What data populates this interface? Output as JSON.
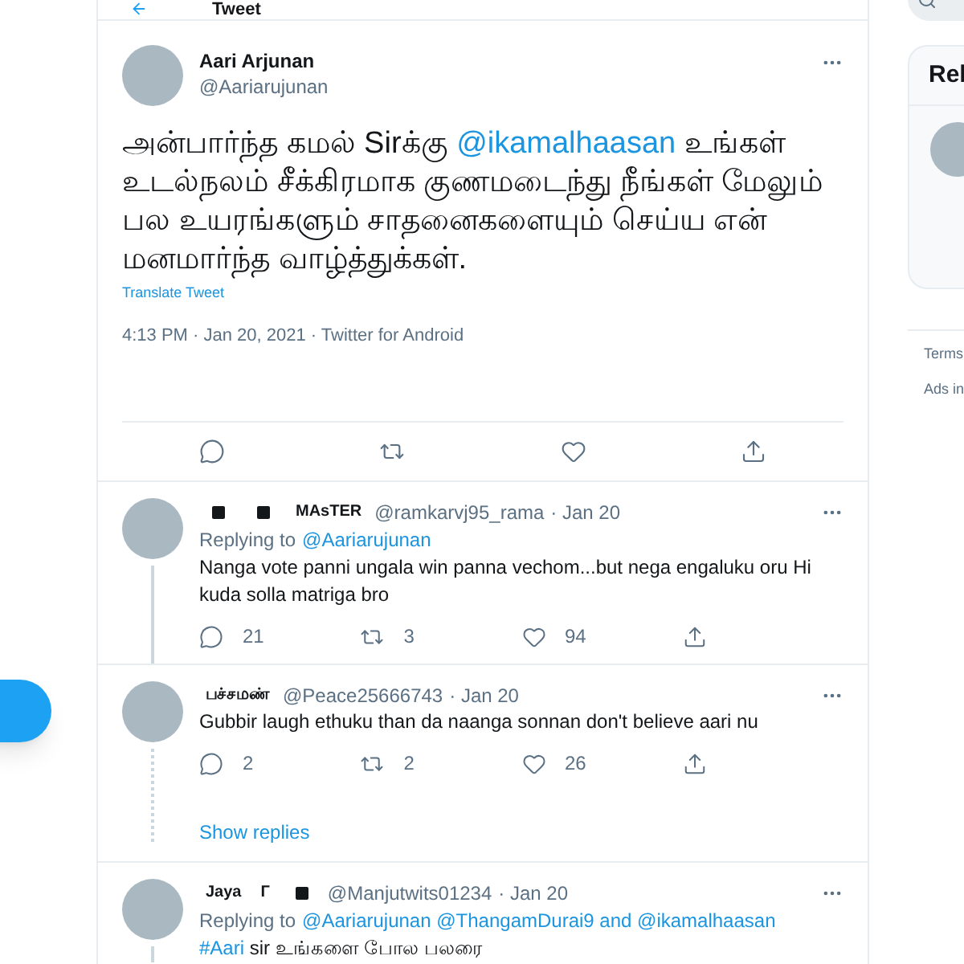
{
  "header": {
    "title": "Tweet"
  },
  "tweet": {
    "name": "Aari Arjunan",
    "handle": "@Aariarujunan",
    "text_parts": [
      {
        "kind": "text",
        "text": "அன்பார்ந்த கமல் Sirக்கு "
      },
      {
        "kind": "mention",
        "text": "@ikamalhaasan"
      },
      {
        "kind": "text",
        "text": " உங்கள் உடல்நலம் சீக்கிரமாக குணமடைந்து நீங்கள் மேலும் பல உயரங்களும் சாதனைகளையும் செய்ய என் மனமார்ந்த வாழ்த்துக்கள்."
      }
    ],
    "translate": "Translate Tweet",
    "meta": "4:13 PM · Jan 20, 2021 · Twitter for Android"
  },
  "replies": [
    {
      "name_parts": [
        {
          "kind": "emoji"
        },
        {
          "kind": "emoji"
        },
        {
          "kind": "text",
          "text": "MAsTER"
        }
      ],
      "handle": "@ramkarvj95_rama",
      "date": "· Jan 20",
      "replying_label": "Replying to",
      "replying_to": "@Aariarujunan",
      "text_parts": [
        {
          "kind": "text",
          "text": "Nanga vote panni ungala win panna vechom...but nega engaluku oru Hi kuda solla matriga bro"
        }
      ],
      "replies": "21",
      "retweets": "3",
      "likes": "94"
    },
    {
      "name_parts": [
        {
          "kind": "text",
          "text": "பச்சமண்"
        }
      ],
      "handle": "@Peace25666743",
      "date": "· Jan 20",
      "text_parts": [
        {
          "kind": "text",
          "text": "Gubbir laugh ethuku than da naanga sonnan don't believe aari nu"
        }
      ],
      "replies": "2",
      "retweets": "2",
      "likes": "26",
      "show_replies": "Show replies"
    },
    {
      "name_parts": [
        {
          "kind": "text",
          "text": "Jaya"
        },
        {
          "kind": "text",
          "text": "Г"
        },
        {
          "kind": "emoji"
        }
      ],
      "handle": "@Manjutwits01234",
      "date": "· Jan 20",
      "replying_label": "Replying to",
      "replying_to": "@Aariarujunan @ThangamDurai9 and @ikamalhaasan",
      "text_parts": [
        {
          "kind": "mention",
          "text": "#Aari"
        },
        {
          "kind": "text",
          "text": " sir உங்களை போல பலரை"
        }
      ]
    }
  ],
  "right": {
    "card_title": "Rel",
    "footer": [
      "Terms",
      "Ads in"
    ]
  }
}
